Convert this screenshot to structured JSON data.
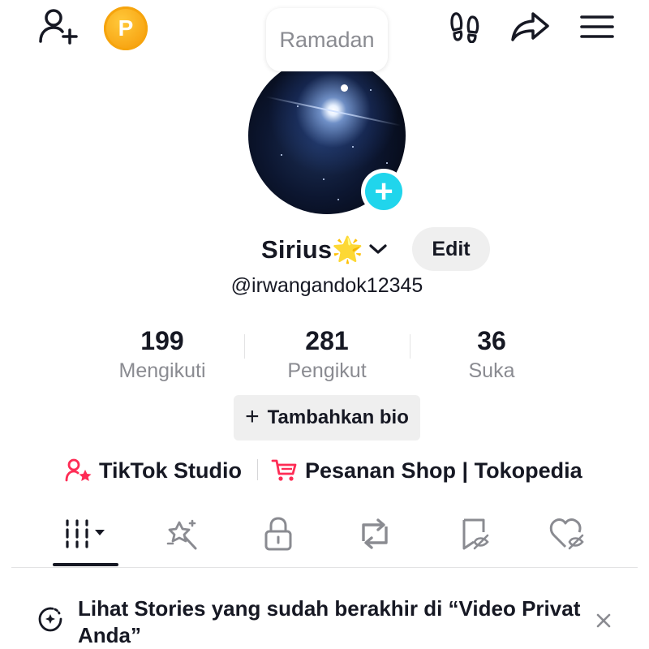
{
  "header": {
    "coin_label": "P",
    "icons": [
      "add-friend-icon",
      "coin-icon",
      "footprints-icon",
      "share-icon",
      "menu-icon"
    ]
  },
  "profile": {
    "note": "Ramadan",
    "display_name": "Sirius🌟",
    "username": "@irwangandok12345",
    "edit_label": "Edit"
  },
  "stats": [
    {
      "value": "199",
      "label": "Mengikuti"
    },
    {
      "value": "281",
      "label": "Pengikut"
    },
    {
      "value": "36",
      "label": "Suka"
    }
  ],
  "bio": {
    "plus": "+",
    "label": "Tambahkan bio"
  },
  "links": {
    "studio": "TikTok Studio",
    "shop": "Pesanan Shop | Tokopedia"
  },
  "tabs": [
    "videos-grid",
    "sparkle",
    "private-lock",
    "reposts",
    "favorites",
    "liked"
  ],
  "banner": {
    "text": "Lihat Stories yang sudah berakhir di “Video Privat Anda”"
  },
  "colors": {
    "accent_cyan": "#20d5ec",
    "link_pink": "#fe2c55",
    "coin_orange": "#f8a513",
    "secondary_text": "#8a8b91"
  }
}
